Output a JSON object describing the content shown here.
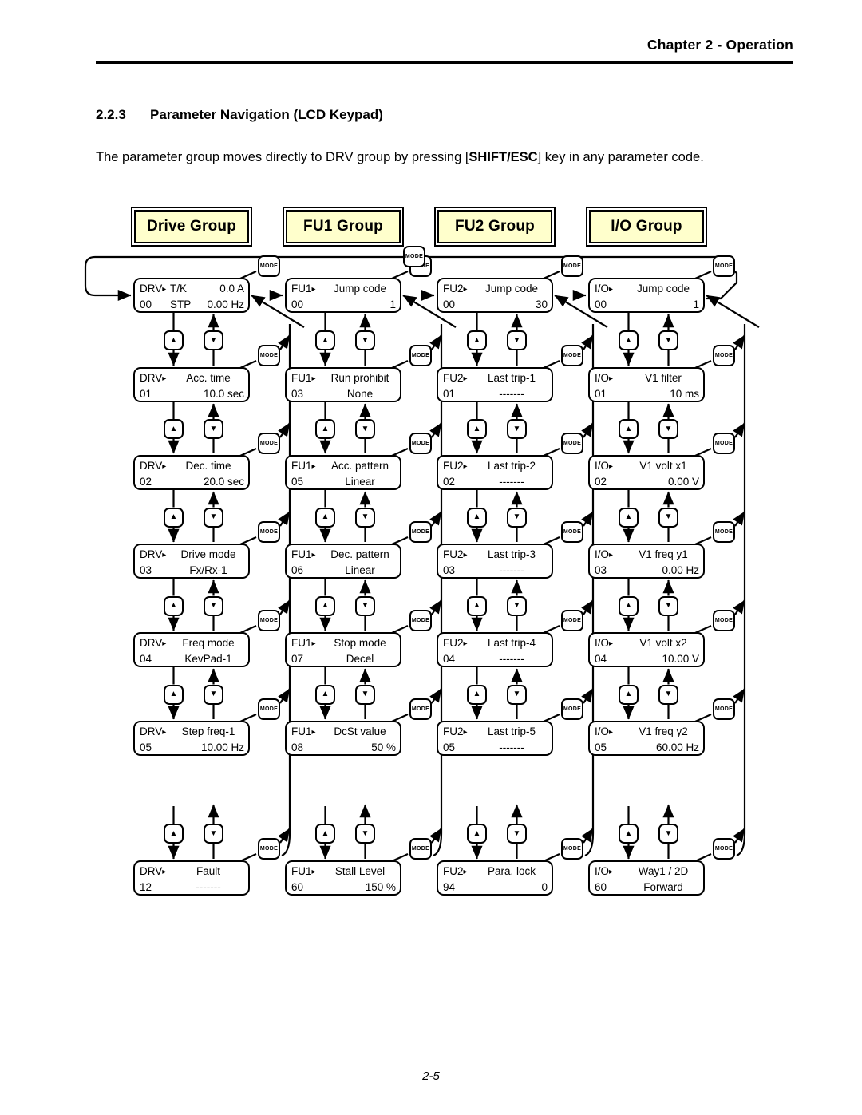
{
  "page": {
    "chapter_header": "Chapter 2 - Operation",
    "footer": "2-5"
  },
  "section": {
    "number": "2.2.3",
    "title": "Parameter Navigation (LCD Keypad)",
    "intro_prefix": "The parameter group moves directly to DRV group by pressing [",
    "intro_key": "SHIFT/ESC",
    "intro_suffix": "] key in any parameter code."
  },
  "keys": {
    "mode_label": "MODE",
    "up_glyph": "▲",
    "down_glyph": "▼",
    "code_arrow": "▸"
  },
  "colors": {
    "group_plate_fill": "#FFFFCC",
    "ink": "#000000",
    "page_background": "#FFFFFF"
  },
  "groups": [
    {
      "id": "drive-group",
      "title": "Drive Group",
      "prefix": "DRV",
      "rows": [
        {
          "code": "00",
          "name": "T/K",
          "mid": "STP",
          "value_top": "0.0 A",
          "value": "0.00 Hz",
          "layout": "status"
        },
        {
          "code": "01",
          "name": "Acc. time",
          "value": "10.0 sec",
          "layout": "param"
        },
        {
          "code": "02",
          "name": "Dec. time",
          "value": "20.0 sec",
          "layout": "param"
        },
        {
          "code": "03",
          "name": "Drive mode",
          "value": "Fx/Rx-1",
          "layout": "param-center"
        },
        {
          "code": "04",
          "name": "Freq mode",
          "value": "KevPad-1",
          "layout": "param-center"
        },
        {
          "code": "05",
          "name": "Step freq-1",
          "value": "10.00 Hz",
          "layout": "param"
        },
        {
          "code": "12",
          "name": "Fault",
          "value": "-------",
          "layout": "param-center",
          "last": true
        }
      ]
    },
    {
      "id": "fu1-group",
      "title": "FU1 Group",
      "prefix": "FU1",
      "rows": [
        {
          "code": "00",
          "name": "Jump code",
          "value": "1",
          "layout": "param"
        },
        {
          "code": "03",
          "name": "Run prohibit",
          "value": "None",
          "layout": "param-center"
        },
        {
          "code": "05",
          "name": "Acc. pattern",
          "value": "Linear",
          "layout": "param-center"
        },
        {
          "code": "06",
          "name": "Dec. pattern",
          "value": "Linear",
          "layout": "param-center"
        },
        {
          "code": "07",
          "name": "Stop mode",
          "value": "Decel",
          "layout": "param-center"
        },
        {
          "code": "08",
          "name": "DcSt value",
          "value": "50 %",
          "layout": "param"
        },
        {
          "code": "60",
          "name": "Stall Level",
          "value": "150 %",
          "layout": "param",
          "last": true
        }
      ]
    },
    {
      "id": "fu2-group",
      "title": "FU2 Group",
      "prefix": "FU2",
      "rows": [
        {
          "code": "00",
          "name": "Jump code",
          "value": "30",
          "layout": "param"
        },
        {
          "code": "01",
          "name": "Last trip-1",
          "value": "-------",
          "layout": "param-center"
        },
        {
          "code": "02",
          "name": "Last trip-2",
          "value": "-------",
          "layout": "param-center"
        },
        {
          "code": "03",
          "name": "Last trip-3",
          "value": "-------",
          "layout": "param-center"
        },
        {
          "code": "04",
          "name": "Last trip-4",
          "value": "-------",
          "layout": "param-center"
        },
        {
          "code": "05",
          "name": "Last trip-5",
          "value": "-------",
          "layout": "param-center"
        },
        {
          "code": "94",
          "name": "Para. lock",
          "value": "0",
          "layout": "param",
          "last": true
        }
      ]
    },
    {
      "id": "io-group",
      "title": "I/O Group",
      "prefix": "I/O",
      "rows": [
        {
          "code": "00",
          "name": "Jump code",
          "value": "1",
          "layout": "param"
        },
        {
          "code": "01",
          "name": "V1 filter",
          "value": "10 ms",
          "layout": "param"
        },
        {
          "code": "02",
          "name": "V1 volt x1",
          "value": "0.00 V",
          "layout": "param"
        },
        {
          "code": "03",
          "name": "V1 freq y1",
          "value": "0.00 Hz",
          "layout": "param"
        },
        {
          "code": "04",
          "name": "V1 volt x2",
          "value": "10.00 V",
          "layout": "param"
        },
        {
          "code": "05",
          "name": "V1 freq y2",
          "value": "60.00 Hz",
          "layout": "param"
        },
        {
          "code": "60",
          "name": "Way1 / 2D",
          "value": "Forward",
          "layout": "param-center",
          "last": true
        }
      ]
    }
  ]
}
